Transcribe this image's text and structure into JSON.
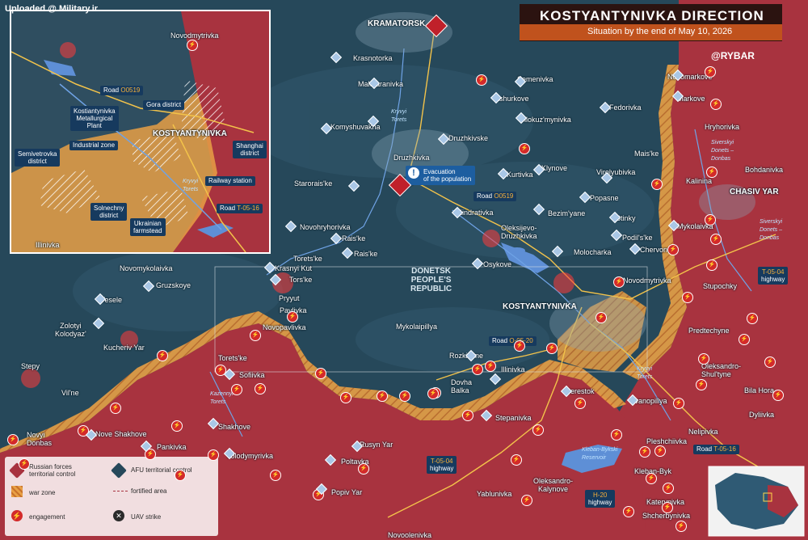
{
  "watermark": "Uploaded @ Military.ir",
  "header": {
    "title": "KOSTYANTYNIVKA DIRECTION",
    "subtitle": "Situation by the end of May 10, 2026",
    "brand": "@RYBAR"
  },
  "colors": {
    "russian_control": "#a8333f",
    "afu_control": "#26485a",
    "war_zone": "#e8a045",
    "engagement": "#d32a2a",
    "road_label_bg": "#163a5e"
  },
  "region_label": [
    "DONETSK",
    "PEOPLE'S",
    "REPUBLIC"
  ],
  "settlements": {
    "kramatorsk": "KRAMATORSK",
    "krasnotorka": "Krasnotorka",
    "malotaranivka": "Malotaranivka",
    "komyshuvakha": "Komyshuvakha",
    "druzhkivka": "Druzhkivka",
    "druzhkivske": "Druzhkivske",
    "starorais_ke": "Starorais'ke",
    "semenivka": "Semenivka",
    "ashurkove": "Ashurkove",
    "bilokuz_mynivka": "Bilokuz'mynivka",
    "novomarkove": "Novomarkove",
    "markove": "Markove",
    "fedorivka": "Fedorivka",
    "hryhorivka": "Hryhorivka",
    "mais_ke": "Mais'ke",
    "bohdanivka": "Bohdanivka",
    "kalinina": "Kalinina",
    "chasiv_yar": "CHASIV YAR",
    "klynove": "Klynove",
    "kurtivka": "Kurtivka",
    "virolyubivka": "Virolyubivka",
    "popasne": "Popasne",
    "bezim_yane": "Bezim'yane",
    "stinky": "Stinky",
    "mykolaivka": "Mykolaivka",
    "podil_s_ke": "Podil's'ke",
    "chervone": "Chervone",
    "kindrativka": "Kindrativka",
    "oleksijevo_druzhkivka": "Oleksijevo-Druzhkivka",
    "molocharka": "Molocharka",
    "osykove": "Osykove",
    "novodmytrivka": "Novodmytrivka",
    "stupochky": "Stupochky",
    "kostyantynivka": "KOSTYANTYNIVKA",
    "predtechyne": "Predtechyne",
    "novohryhorivka": "Novohryhorivka",
    "rais_ke_1": "Rais'ke",
    "rais_ke_2": "Rais'ke",
    "torets_ke_1": "Torets'ke",
    "krasnyi_kut": "Krasnyi Kut",
    "tors_ke": "Tors'ke",
    "pryyut": "Pryyut",
    "pavlivka": "Pavlivka",
    "novopavlivka": "Novopavlivka",
    "mykolaipillya": "Mykolaipillya",
    "novomykolaivka": "Novomykolaivka",
    "gruzskoye": "Gruzskoye",
    "vesele": "Vesele",
    "zolotyi_kolodyaz": "Zolotyi\nKolodyaz'",
    "kucheriv_yar": "Kucheriv Yar",
    "stepy": "Stepy",
    "vil_ne": "Vil'ne",
    "torets_ke_2": "Torets'ke",
    "sofiivka": "Sofiivka",
    "rozkishne": "Rozkishne",
    "illinivka": "Illinivka",
    "dovha_balka": "Dovha\nBalka",
    "berestok": "Berestok",
    "ivanopillya": "Ivanopillya",
    "oleksandro_shultyne": "Oleksandro-\nShul'tyne",
    "bila_hora": "Bila Hora",
    "dyliivka": "Dyliivka",
    "stepanivka": "Stepanivka",
    "nelipivka": "Nelipivka",
    "pleshchiivka": "Pleshchiivka",
    "novyi_donbas": "Novyi\nDonbas",
    "nove_shakhove": "Nove Shakhove",
    "shakhove": "Shakhove",
    "pankivka": "Pankivka",
    "volodymyrivka": "Volodymyrivka",
    "rusyn_yar": "Rusyn Yar",
    "poltavka": "Poltavka",
    "popiv_yar": "Popiv Yar",
    "oleksandro_kalynove": "Oleksandro-\nKalynove",
    "yablunivka": "Yablunivka",
    "kleban_byk": "Kleban-Byk",
    "katerynivka": "Katerynivka",
    "shcherbynivka": "Shcherbynivka",
    "novoolenivka": "Novoolenivka"
  },
  "rivers": {
    "kryvyi_torets_1": "Kryvyi\nTorets",
    "kryvyi_torets_2": "Kryvyi\nTorets",
    "kazennyi_torets": "Kazennyi\nTorets",
    "siverskyi_donets_1": "Siverskyi\nDonets –\nDonbas",
    "siverskyi_donets_2": "Siverskyi\nDonets –\nDonbas",
    "kleban_byk_reservoir": "Kleban-Bykski\nReservoir"
  },
  "roads": {
    "o0519_main": {
      "prefix": "Road",
      "code": "O0519"
    },
    "t0504_main": {
      "prefix": "T-05-04",
      "code": "highway"
    },
    "o0520": {
      "prefix": "Road",
      "code": "O-05-20"
    },
    "t0516_main": {
      "prefix": "Road",
      "code": "T-05-16"
    },
    "t0504_south": {
      "prefix": "T-05-04",
      "code": "highway"
    },
    "h20": {
      "prefix": "H-20",
      "code": "highway"
    }
  },
  "callout": {
    "line1": "Evacuation",
    "line2": "of the population"
  },
  "inset": {
    "settlements": {
      "novodmytrivka": "Novodmytrivka",
      "illinivka": "Illinivka",
      "kostyantynivka": "KOSTYANTYNIVKA"
    },
    "river": "Kryvyi\nTorets",
    "labels": {
      "road_o0519": {
        "prefix": "Road",
        "code": "O0519"
      },
      "metallurgical": "Kostiantynivka\nMetallurgical\nPlant",
      "gora": "Gora district",
      "industrial": "Industrial zone",
      "shanghai": "Shanghai\ndistrict",
      "semivetrovka": "Semivetrovka\ndistrict",
      "railway": "Railway station",
      "solnechny": "Solnechny\ndistrict",
      "road_t0516": {
        "prefix": "Road",
        "code": "T-05-16"
      },
      "farmstead": "Ukrainian\nfarmstead"
    }
  },
  "legend": {
    "russian": "Russian forces\nterritorial control",
    "afu": "AFU territorial control",
    "war_zone": "war zone",
    "fortified": "fortified area",
    "engagement": "engagement",
    "uav": "UAV strike"
  }
}
